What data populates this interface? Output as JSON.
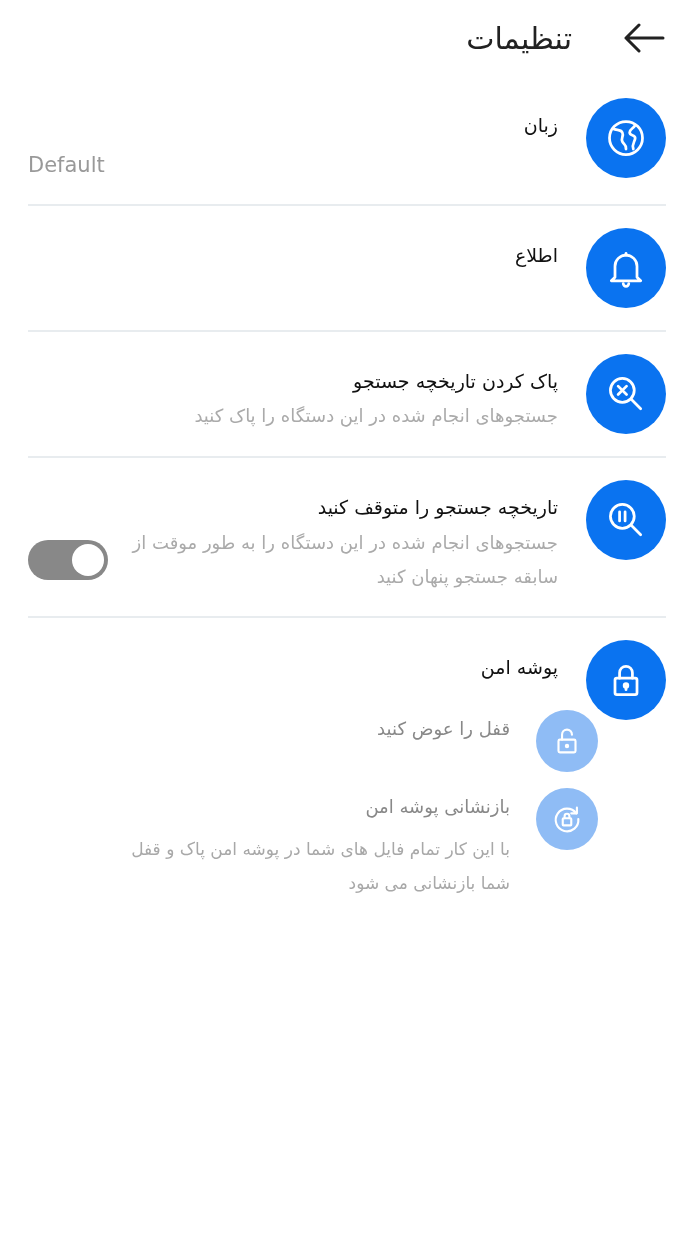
{
  "header": {
    "title": "تنظیمات"
  },
  "items": [
    {
      "kind": "item",
      "title": "زبان",
      "value": "Default"
    },
    {
      "kind": "item",
      "title": "اطلاع"
    },
    {
      "kind": "item",
      "title": "پاک کردن تاریخچه جستجو",
      "description": "جستجوهای انجام شده در این دستگاه را پاک کنید"
    },
    {
      "kind": "toggle",
      "title": "تاریخچه جستجو را متوقف کنید",
      "description": "جستجوهای انجام شده در این دستگاه را به طور موقت از سابقه جستجو پنهان کنید",
      "on": true
    },
    {
      "kind": "group",
      "title": "پوشه امن",
      "children": [
        {
          "title": "قفل را عوض کنید",
          "disabled": true
        },
        {
          "title": "بازنشانی پوشه امن",
          "description": "با این کار تمام فایل های شما در پوشه امن پاک و قفل شما بازنشانی می شود",
          "disabled": true
        }
      ]
    }
  ]
}
